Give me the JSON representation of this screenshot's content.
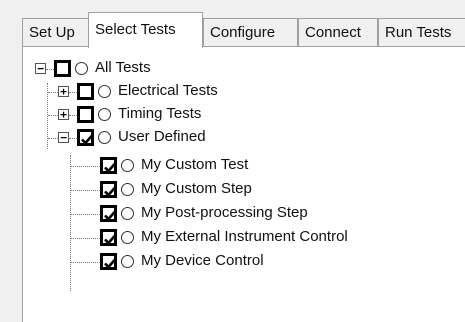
{
  "tabs": [
    {
      "label": "Set Up",
      "active": false
    },
    {
      "label": "Select Tests",
      "active": true
    },
    {
      "label": "Configure",
      "active": false
    },
    {
      "label": "Connect",
      "active": false
    },
    {
      "label": "Run Tests",
      "active": false
    }
  ],
  "tree": {
    "root": {
      "label": "All Tests",
      "checked": false,
      "expanded": true
    },
    "groups": [
      {
        "label": "Electrical Tests",
        "checked": false,
        "expanded": false
      },
      {
        "label": "Timing Tests",
        "checked": false,
        "expanded": false
      },
      {
        "label": "User Defined",
        "checked": true,
        "expanded": true
      }
    ],
    "user_defined_items": [
      {
        "label": "My Custom Test",
        "checked": true
      },
      {
        "label": "My Custom Step",
        "checked": true
      },
      {
        "label": "My Post-processing Step",
        "checked": true
      },
      {
        "label": "My External Instrument Control",
        "checked": true
      },
      {
        "label": "My Device Control",
        "checked": true
      }
    ],
    "expander_symbols": {
      "collapsed": "+",
      "expanded": "−"
    }
  }
}
